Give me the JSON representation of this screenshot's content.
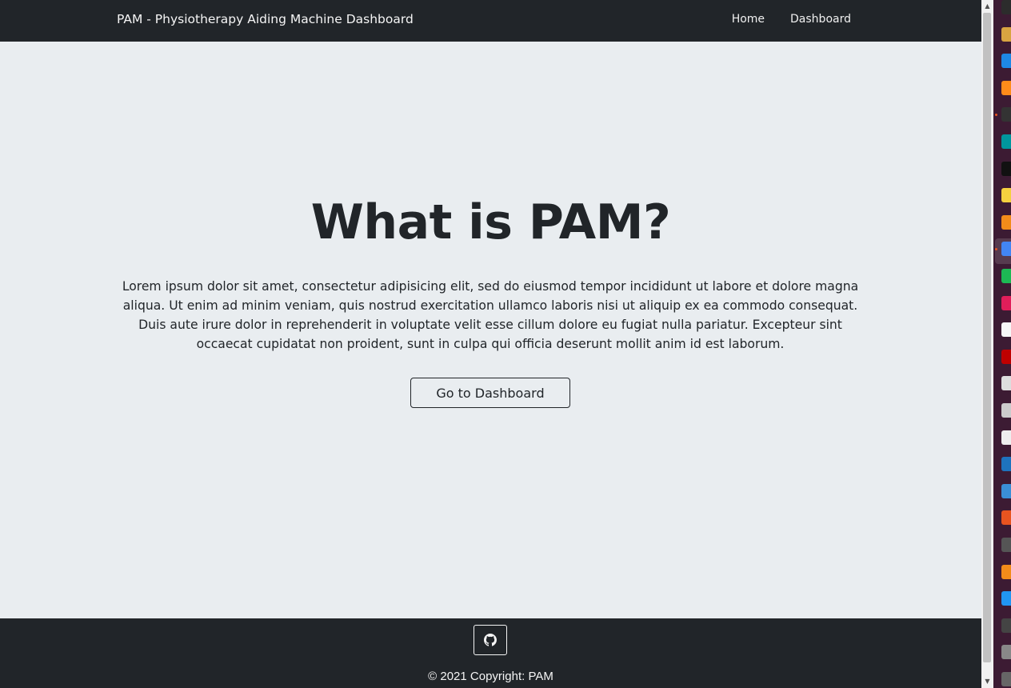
{
  "navbar": {
    "brand": "PAM - Physiotherapy Aiding Machine Dashboard",
    "links": [
      {
        "label": "Home"
      },
      {
        "label": "Dashboard"
      }
    ]
  },
  "hero": {
    "title": "What is PAM?",
    "text": "Lorem ipsum dolor sit amet, consectetur adipisicing elit, sed do eiusmod tempor incididunt ut labore et dolore magna aliqua. Ut enim ad minim veniam, quis nostrud exercitation ullamco laboris nisi ut aliquip ex ea commodo consequat. Duis aute irure dolor in reprehenderit in voluptate velit esse cillum dolore eu fugiat nulla pariatur. Excepteur sint occaecat cupidatat non proident, sunt in culpa qui officia deserunt mollit anim id est laborum.",
    "button_label": "Go to Dashboard"
  },
  "footer": {
    "github_icon": "github-icon",
    "copyright": "© 2021 Copyright: PAM"
  },
  "colors": {
    "navbar_bg": "#212529",
    "page_bg": "#e9edf0",
    "text": "#212529",
    "dock_bg": "#3c1b33"
  },
  "dock": {
    "apps": [
      {
        "icon": "terminal-icon",
        "color": "#2c2c2c"
      },
      {
        "icon": "app-icon",
        "color": "#d9a441"
      },
      {
        "icon": "vscode-icon",
        "color": "#1e88e5"
      },
      {
        "icon": "sublime-icon",
        "color": "#ff8c1a"
      },
      {
        "icon": "terminal-icon",
        "color": "#333333"
      },
      {
        "icon": "arduino-icon",
        "color": "#00979d"
      },
      {
        "icon": "obs-icon",
        "color": "#111111"
      },
      {
        "icon": "notes-icon",
        "color": "#f4d03f"
      },
      {
        "icon": "vlc-icon",
        "color": "#f28c1a"
      },
      {
        "icon": "chrome-icon",
        "color": "#4285f4"
      },
      {
        "icon": "spotify-icon",
        "color": "#1db954"
      },
      {
        "icon": "slack-icon",
        "color": "#e01e5a"
      },
      {
        "icon": "files-icon",
        "color": "#f7f7f7"
      },
      {
        "icon": "filezilla-icon",
        "color": "#bf0000"
      },
      {
        "icon": "calculator-icon",
        "color": "#dddddd"
      },
      {
        "icon": "camera-icon",
        "color": "#cccccc"
      },
      {
        "icon": "text-editor-icon",
        "color": "#eeeeee"
      },
      {
        "icon": "update-icon",
        "color": "#1e73be"
      },
      {
        "icon": "image-viewer-icon",
        "color": "#3a8fd6"
      },
      {
        "icon": "software-icon",
        "color": "#e95420"
      },
      {
        "icon": "usb-icon",
        "color": "#555555"
      },
      {
        "icon": "vlc-icon",
        "color": "#f28c1a"
      },
      {
        "icon": "ide-icon",
        "color": "#2196f3"
      },
      {
        "icon": "inkscape-icon",
        "color": "#444444"
      },
      {
        "icon": "disk-icon",
        "color": "#888888"
      },
      {
        "icon": "more-icon",
        "color": "#666666"
      }
    ]
  }
}
